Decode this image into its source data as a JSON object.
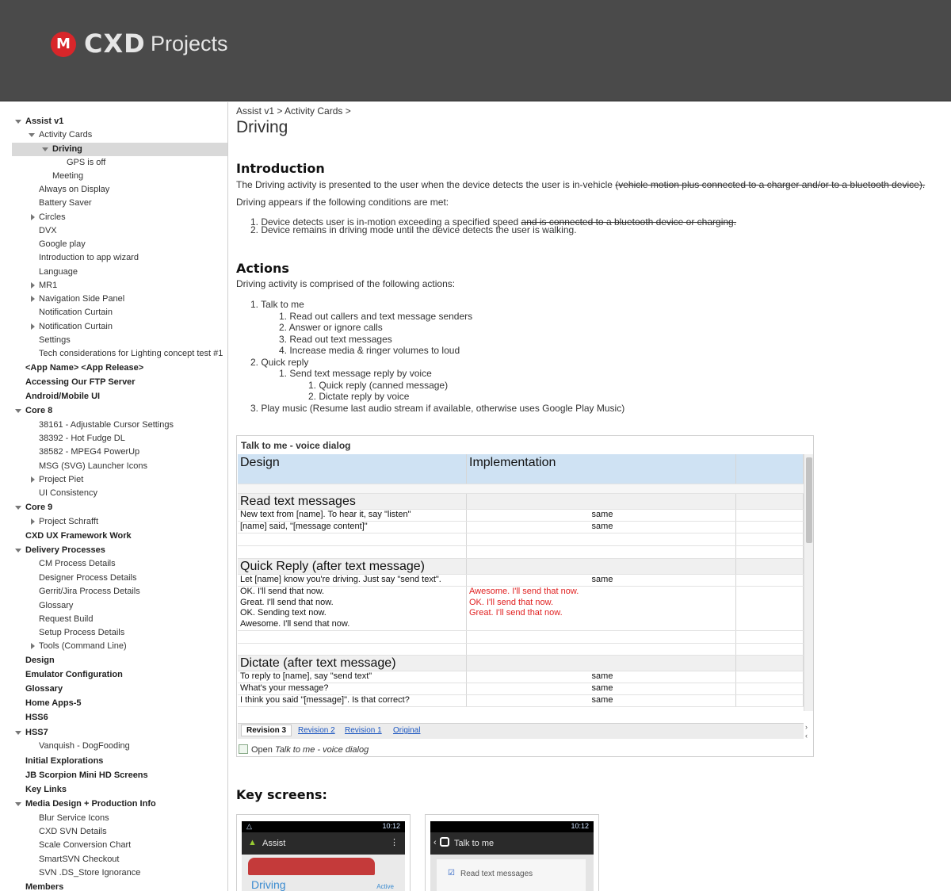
{
  "header": {
    "logo_letter": "M",
    "brand": "CXD",
    "title": "Projects"
  },
  "sidebar": [
    {
      "label": "Assist v1",
      "bold": true,
      "arrow": "down"
    },
    {
      "label": "Activity Cards",
      "arrow": "down"
    },
    {
      "label": "Driving",
      "bold": true,
      "arrow": "down",
      "selected": true
    },
    {
      "label": "GPS is off"
    },
    {
      "label": "Meeting"
    },
    {
      "label": "Always on Display"
    },
    {
      "label": "Battery Saver"
    },
    {
      "label": "Circles",
      "arrow": "right"
    },
    {
      "label": "DVX"
    },
    {
      "label": "Google play"
    },
    {
      "label": "Introduction to app wizard"
    },
    {
      "label": "Language"
    },
    {
      "label": "MR1",
      "arrow": "right"
    },
    {
      "label": "Navigation Side Panel",
      "arrow": "right"
    },
    {
      "label": "Notification Curtain"
    },
    {
      "label": "Notification Curtain",
      "arrow": "right"
    },
    {
      "label": "Settings"
    },
    {
      "label": "Tech considerations for Lighting concept test #1"
    },
    {
      "label": "<App Name> <App Release>",
      "bold": true
    },
    {
      "label": "Accessing Our FTP Server",
      "bold": true
    },
    {
      "label": "Android/Mobile UI",
      "bold": true
    },
    {
      "label": "Core 8",
      "bold": true,
      "arrow": "down"
    },
    {
      "label": "38161 - Adjustable Cursor Settings"
    },
    {
      "label": "38392 - Hot Fudge DL"
    },
    {
      "label": "38582 - MPEG4 PowerUp"
    },
    {
      "label": "MSG (SVG) Launcher Icons"
    },
    {
      "label": "Project Piet",
      "arrow": "right"
    },
    {
      "label": "UI Consistency"
    },
    {
      "label": "Core 9",
      "bold": true,
      "arrow": "down"
    },
    {
      "label": "Project Schrafft",
      "arrow": "right"
    },
    {
      "label": "CXD UX Framework Work",
      "bold": true
    },
    {
      "label": "Delivery Processes",
      "bold": true,
      "arrow": "down"
    },
    {
      "label": "CM Process Details"
    },
    {
      "label": "Designer Process Details"
    },
    {
      "label": "Gerrit/Jira Process Details"
    },
    {
      "label": "Glossary"
    },
    {
      "label": "Request Build"
    },
    {
      "label": "Setup Process Details"
    },
    {
      "label": "Tools (Command Line)",
      "arrow": "right"
    },
    {
      "label": "Design",
      "bold": true
    },
    {
      "label": "Emulator Configuration",
      "bold": true
    },
    {
      "label": "Glossary",
      "bold": true
    },
    {
      "label": "Home Apps-5",
      "bold": true
    },
    {
      "label": "HSS6",
      "bold": true
    },
    {
      "label": "HSS7",
      "bold": true,
      "arrow": "down"
    },
    {
      "label": "Vanquish - DogFooding"
    },
    {
      "label": "Initial Explorations",
      "bold": true
    },
    {
      "label": "JB Scorpion Mini HD Screens",
      "bold": true
    },
    {
      "label": "Key Links",
      "bold": true
    },
    {
      "label": "Media Design + Production Info",
      "bold": true,
      "arrow": "down"
    },
    {
      "label": "Blur Service Icons"
    },
    {
      "label": "CXD SVN Details"
    },
    {
      "label": "Scale Conversion Chart"
    },
    {
      "label": "SmartSVN Checkout"
    },
    {
      "label": "SVN .DS_Store Ignorance"
    },
    {
      "label": "Members",
      "bold": true
    }
  ],
  "main": {
    "breadcrumb": "Assist v1 > Activity Cards >",
    "title": "Driving",
    "intro_heading": "Introduction",
    "intro_text": "The Driving activity is presented to the user when the device detects the user is in-vehicle",
    "intro_struck": "(vehicle motion plus connected to a charger and/or to a bluetooth device).",
    "conditions_text": "Driving appears if the following conditions are met:",
    "cond1": "1.  Device detects user is in-motion exceeding a specified speed",
    "cond1_struck": "and is connected to a bluetooth device or charging.",
    "cond2": "2.  Device remains in driving mode until the device detects the user is walking.",
    "actions_heading": "Actions",
    "actions_text": "Driving activity is comprised of the following actions:",
    "actions": [
      "1.  Talk to me",
      "1.  Read out callers and text message senders",
      "2.  Answer or ignore calls",
      "3.  Read out text messages",
      "4.  Increase media & ringer volumes to loud",
      "2.  Quick reply",
      "1.  Send text message reply by voice",
      "1.  Quick reply (canned message)",
      "2.  Dictate reply by voice",
      "3.  Play music (Resume last audio stream if available, otherwise uses Google Play Music)"
    ],
    "key_screens_heading": "Key screens:"
  },
  "doc": {
    "title": "Talk to me - voice dialog",
    "col_design": "Design",
    "col_impl": "Implementation",
    "sec1": "Read text messages",
    "r1a": "New text from [name]. To hear it, say \"listen\"",
    "r1b": "[name] said, \"[message content]\"",
    "same": "same",
    "sec2": "Quick Reply (after text message)",
    "r2a": "Let [name] know you're driving. Just say \"send text\".",
    "r2b": [
      "OK. I'll send that now.",
      "Great. I'll send that now.",
      "OK. Sending text now.",
      "Awesome. I'll send that now."
    ],
    "r2b_impl": [
      "Awesome. I'll send that now.",
      "OK. I'll send that now.",
      "Great. I'll send that now."
    ],
    "sec3": "Dictate (after text message)",
    "r3a": "To reply to [name], say \"send text\"",
    "r3b": "What's your message?",
    "r3c": "I think you said \"[message]\". Is that correct?",
    "tabs": [
      "Revision 3",
      "Revision 2",
      "Revision 1",
      "Original"
    ],
    "open_prefix": "Open",
    "open_name": "Talk to me - voice dialog"
  },
  "screens": {
    "s1": {
      "time": "10:12",
      "title": "Assist",
      "card": "Driving",
      "badge": "Active"
    },
    "s2": {
      "time": "10:12",
      "title": "Talk to me",
      "item": "Read text messages"
    }
  },
  "colors": {
    "header_bg": "#4a4a4a",
    "table_header": "#cfe2f3",
    "section_row": "#f0f0f0",
    "accent_red": "#e02020"
  }
}
